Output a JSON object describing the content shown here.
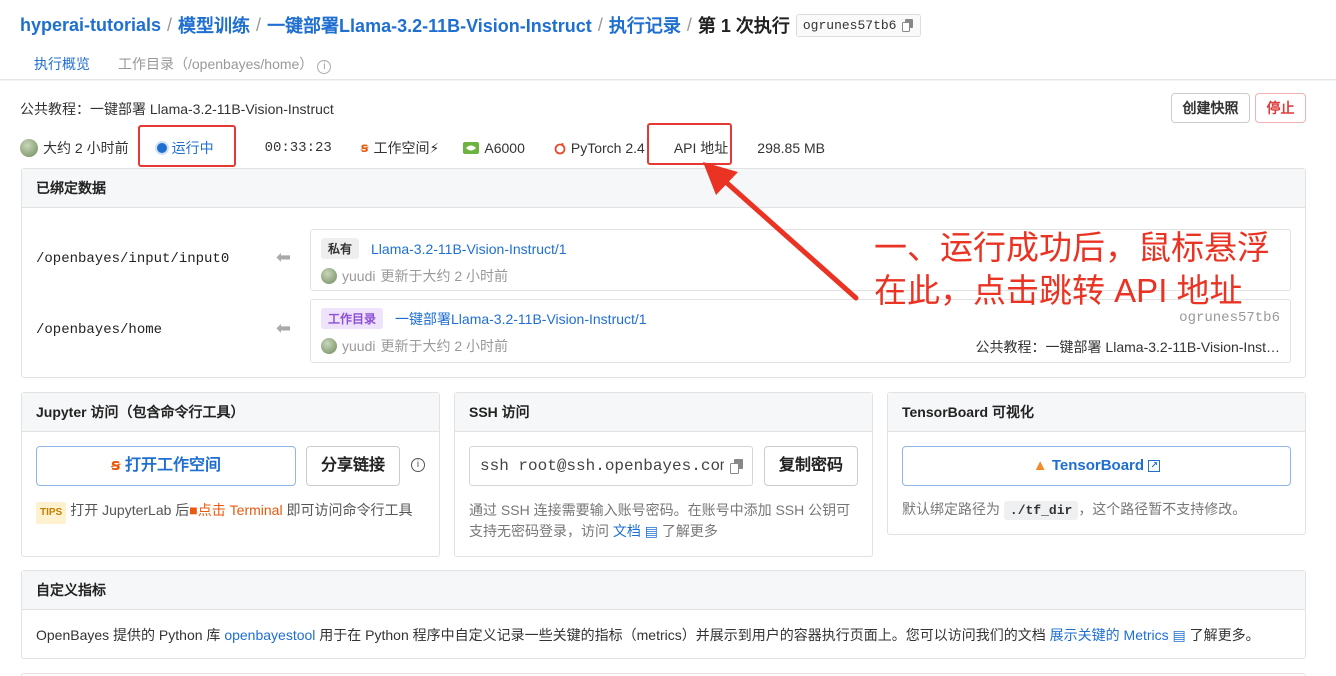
{
  "breadcrumb": {
    "items": [
      "hyperai-tutorials",
      "模型训练",
      "一键部署Llama-3.2-11B-Vision-Instruct",
      "执行记录"
    ],
    "current": "第 1 次执行",
    "separator": "/",
    "id_tag": "ogrunes57tb6"
  },
  "tabs": [
    {
      "label": "执行概览",
      "active": true
    },
    {
      "label": "工作目录（/openbayes/home）",
      "active": false
    }
  ],
  "header": {
    "title": "公共教程：一键部署 Llama-3.2-11B-Vision-Instruct",
    "snapshot_button": "创建快照",
    "stop_button": "停止"
  },
  "status": {
    "time_ago": "大约 2 小时前",
    "state": "运行中",
    "duration": "00:33:23",
    "workspace": "工作空间⚡",
    "gpu": "A6000",
    "framework": "PyTorch 2.4",
    "api": "API 地址",
    "size": "298.85 MB"
  },
  "bound_data": {
    "title": "已绑定数据",
    "mounts": [
      {
        "path": "/openbayes/input/input0",
        "badge": "私有",
        "name": "Llama-3.2-11B-Vision-Instruct/1",
        "user": "yuudi",
        "updated": "更新于大约 2 小时前",
        "right_id": "",
        "right_desc": ""
      },
      {
        "path": "/openbayes/home",
        "badge": "工作目录",
        "name": "一键部署Llama-3.2-11B-Vision-Instruct/1",
        "user": "yuudi",
        "updated": "更新于大约 2 小时前",
        "right_id": "ogrunes57tb6",
        "right_desc": "公共教程：一键部署 Llama-3.2-11B-Vision-Inst…"
      }
    ]
  },
  "jupyter": {
    "title": "Jupyter 访问（包含命令行工具）",
    "open_button": "打开工作空间",
    "share_button": "分享链接",
    "tips_badge": "TIPS",
    "tips_text_1": "打开 JupyterLab 后",
    "tips_link": "点击 Terminal",
    "tips_text_2": " 即可访问命令行工具"
  },
  "ssh": {
    "title": "SSH 访问",
    "command": "ssh root@ssh.openbayes.com",
    "copy_button": "复制密码",
    "desc_1": "通过 SSH 连接需要输入账号密码。在账号中添加 SSH 公钥可支持无密码登录，访问 ",
    "desc_link": "文档",
    "desc_2": " 了解更多"
  },
  "tensorboard": {
    "title": "TensorBoard 可视化",
    "button": "TensorBoard",
    "desc_1": "默认绑定路径为",
    "desc_code": "./tf_dir",
    "desc_2": "，这个路径暂不支持修改。"
  },
  "metrics": {
    "title": "自定义指标",
    "text_1": "OpenBayes 提供的 Python 库 ",
    "link_1": "openbayestool",
    "text_2": " 用于在 Python 程序中自定义记录一些关键的指标（metrics）并展示到用户的容器执行页面上。您可以访问我们的文档 ",
    "link_2": "展示关键的 Metrics",
    "text_3": " 了解更多。"
  },
  "annotation": {
    "line1": "一、运行成功后，鼠标悬浮",
    "line2": "在此，点击跳转 API 地址",
    "color": "#ea3323"
  },
  "colors": {
    "accent": "#1f6fd1",
    "danger": "#e03a3a",
    "orange": "#e8590c"
  }
}
